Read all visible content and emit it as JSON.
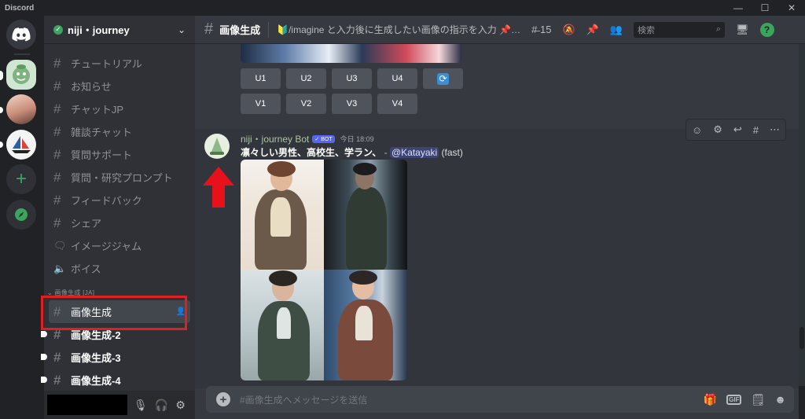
{
  "titlebar": {
    "app_name": "Discord"
  },
  "window_controls": {
    "minimize": "—",
    "maximize": "☐",
    "close": "✕"
  },
  "guild": {
    "name": "niji・journey"
  },
  "channels": [
    {
      "name": "チュートリアル",
      "icon": "hash-icon"
    },
    {
      "name": "お知らせ",
      "icon": "hash-icon"
    },
    {
      "name": "チャットJP",
      "icon": "hash-icon"
    },
    {
      "name": "雑談チャット",
      "icon": "hash-icon"
    },
    {
      "name": "質問サポート",
      "icon": "hash-icon"
    },
    {
      "name": "質問・研究プロンプト",
      "icon": "hash-icon"
    },
    {
      "name": "フィードバック",
      "icon": "hash-icon"
    },
    {
      "name": "シェア",
      "icon": "hash-icon"
    },
    {
      "name": "イメージジャム",
      "icon": "forum-icon"
    },
    {
      "name": "ボイス",
      "icon": "speaker-icon"
    }
  ],
  "category": {
    "label": "画像生成 [JA]"
  },
  "gen_channels": [
    {
      "name": "画像生成",
      "active": true
    },
    {
      "name": "画像生成-2",
      "unread": true
    },
    {
      "name": "画像生成-3",
      "unread": true
    },
    {
      "name": "画像生成-4",
      "unread": true
    }
  ],
  "topbar": {
    "channel_name": "画像生成",
    "topic": "🔰/imagine と入力後に生成したい画像の指示を入力 📌ピン...",
    "threads_count": "15",
    "search_placeholder": "検索",
    "help": "?"
  },
  "upscale_buttons": [
    "U1",
    "U2",
    "U3",
    "U4"
  ],
  "variation_buttons": [
    "V1",
    "V2",
    "V3",
    "V4"
  ],
  "message": {
    "author": "niji・journey Bot",
    "bot_badge": "✓ BOT",
    "timestamp": "今日 18:09",
    "prompt": "凛々しい男性、高校生、学ラン、",
    "separator": "-",
    "mention": "@Katayaki",
    "speed": "(fast)"
  },
  "composer": {
    "placeholder": "#画像生成へメッセージを送信",
    "gif_label": "GIF"
  },
  "colors": {
    "accent_red": "#e02020",
    "online_green": "#3ba55d",
    "blurple": "#5865f2"
  }
}
